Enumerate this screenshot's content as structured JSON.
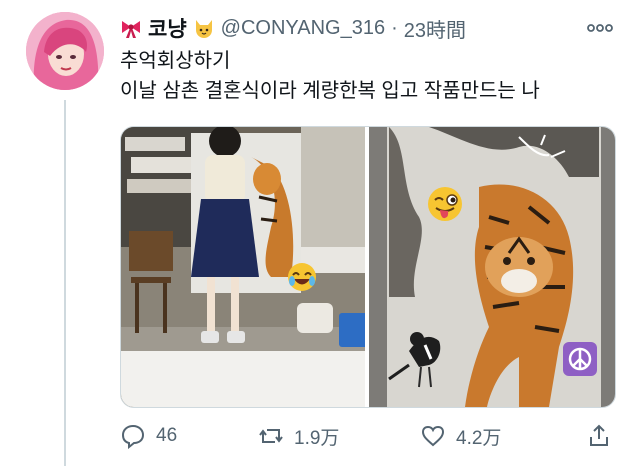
{
  "tweet": {
    "display_name": "코냥",
    "handle": "@CONYANG_316",
    "separator": "·",
    "time": "23時間",
    "lines": [
      "추억회상하기",
      "이날 삼촌 결혼식이라 계량한복 입고 작품만드는 나"
    ]
  },
  "media": [
    {
      "emoji": "😂",
      "icon": "laughing-emoji"
    },
    {
      "emoji": "😜",
      "icon": "winking-tongue-emoji",
      "badge": "☮",
      "badge_icon": "peace-symbol"
    }
  ],
  "actions": {
    "reply_count": "46",
    "retweet_count": "1.9万",
    "like_count": "4.2万"
  },
  "colors": {
    "text": "#0f1419",
    "secondary": "#536471",
    "line": "#cfd9de",
    "badge": "#8e5fc4"
  }
}
